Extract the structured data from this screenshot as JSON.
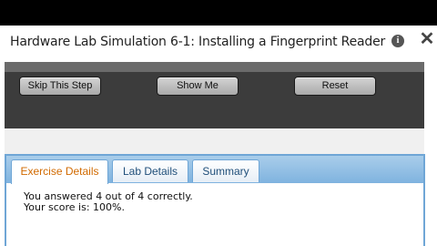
{
  "window": {
    "title": "Hardware Lab Simulation 6-1: Installing a Fingerprint Reader",
    "info_icon": "i",
    "close_icon": "✕"
  },
  "toolbar": {
    "skip_label": "Skip This Step",
    "show_label": "Show Me",
    "reset_label": "Reset"
  },
  "tabs": [
    {
      "label": "Exercise Details",
      "active": true
    },
    {
      "label": "Lab Details",
      "active": false
    },
    {
      "label": "Summary",
      "active": false
    }
  ],
  "content": {
    "line1": "You answered 4 out of 4 correctly.",
    "line2": "Your score is: 100%."
  },
  "colors": {
    "active_tab_text": "#d16a00",
    "tab_bar": "#7fb3df",
    "toolbar_bg": "#3c3c3c"
  }
}
